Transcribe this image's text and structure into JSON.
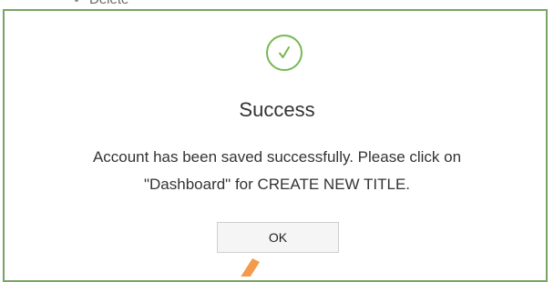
{
  "background": {
    "partial_text": "Delete"
  },
  "dialog": {
    "icon": "check-circle-icon",
    "title": "Success",
    "message_line1": "Account has been saved successfully. Please click on",
    "message_line2": "\"Dashboard\" for CREATE NEW TITLE.",
    "ok_label": "OK"
  },
  "colors": {
    "dialog_border": "#79a564",
    "success_green": "#76b852",
    "annotation_arrow": "#f39a4c"
  }
}
